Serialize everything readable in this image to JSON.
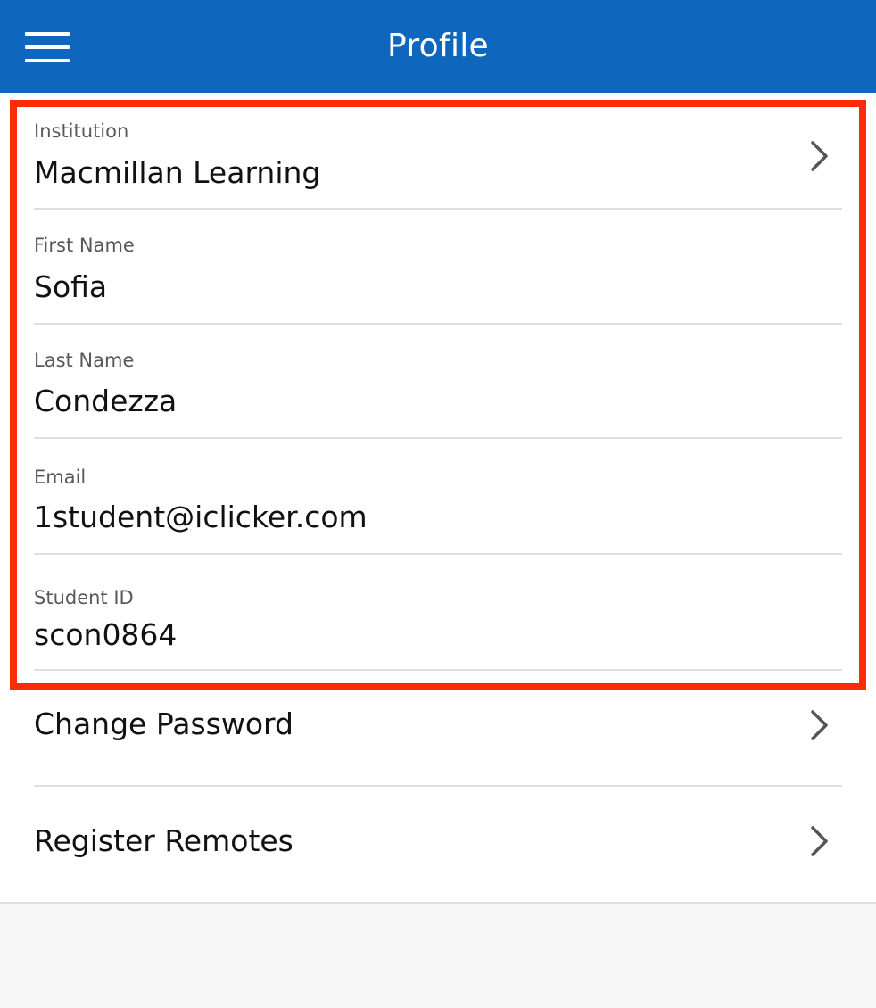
{
  "header": {
    "title": "Profile",
    "menu_icon": "hamburger-menu-icon"
  },
  "fields": [
    {
      "label": "Institution",
      "value": "Macmillan Learning",
      "icon": "chevron-right-icon"
    },
    {
      "label": "First Name",
      "value": "Sofia"
    },
    {
      "label": "Last Name",
      "value": "Condezza"
    },
    {
      "label": "Email",
      "value": "1student@iclicker.com"
    },
    {
      "label": "Student ID",
      "value": "scon0864"
    }
  ],
  "links": [
    {
      "label": "Change Password",
      "icon": "chevron-right-icon"
    },
    {
      "label": "Register Remotes",
      "icon": "chevron-right-icon"
    }
  ],
  "colors": {
    "header_bg": "#0e66bd",
    "highlight_border": "#ff2a06",
    "divider": "#dedede",
    "page_bg": "#f7f7f7"
  }
}
